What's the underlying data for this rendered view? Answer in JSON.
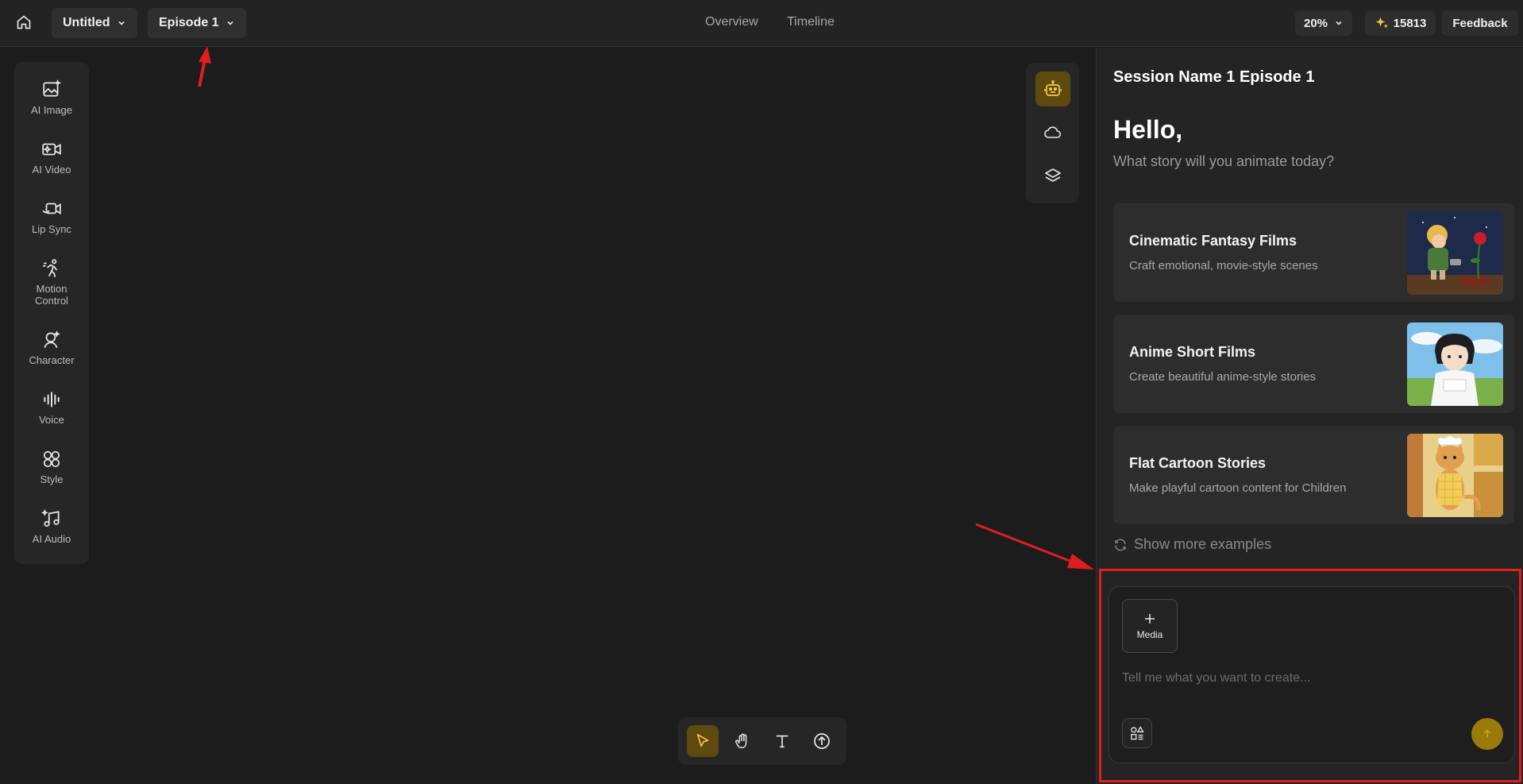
{
  "topbar": {
    "project_label": "Untitled",
    "episode_label": "Episode 1",
    "nav": [
      "Overview",
      "Timeline"
    ],
    "zoom": "20%",
    "credits_icon": "sparkles-icon",
    "credits": "15813",
    "feedback_label": "Feedback"
  },
  "tools": [
    {
      "label": "AI Image",
      "icon": "ai-image-icon"
    },
    {
      "label": "AI Video",
      "icon": "ai-video-icon"
    },
    {
      "label": "Lip Sync",
      "icon": "lip-sync-icon"
    },
    {
      "label": "Motion Control",
      "icon": "motion-control-icon"
    },
    {
      "label": "Character",
      "icon": "character-icon"
    },
    {
      "label": "Voice",
      "icon": "voice-icon"
    },
    {
      "label": "Style",
      "icon": "style-icon"
    },
    {
      "label": "AI Audio",
      "icon": "ai-audio-icon"
    }
  ],
  "right_tools": [
    "robot-icon",
    "cloud-icon",
    "layers-icon"
  ],
  "bottom_tools": [
    "pointer-icon",
    "hand-icon",
    "text-icon",
    "upload-icon"
  ],
  "panel": {
    "session_title": "Session Name 1 Episode 1",
    "greeting": "Hello,",
    "subtitle": "What story will you animate today?",
    "cards": [
      {
        "title": "Cinematic Fantasy Films",
        "desc": "Craft emotional, movie-style scenes"
      },
      {
        "title": "Anime Short Films",
        "desc": "Create beautiful anime-style stories"
      },
      {
        "title": "Flat Cartoon Stories",
        "desc": "Make playful cartoon content for Children"
      }
    ],
    "more_label": "Show more examples",
    "media_label": "Media",
    "prompt_placeholder": "Tell me what you want to create..."
  },
  "colors": {
    "accent": "#9a7a08",
    "accent_dark": "#5e4a0f",
    "annotation": "#e01e1e"
  }
}
